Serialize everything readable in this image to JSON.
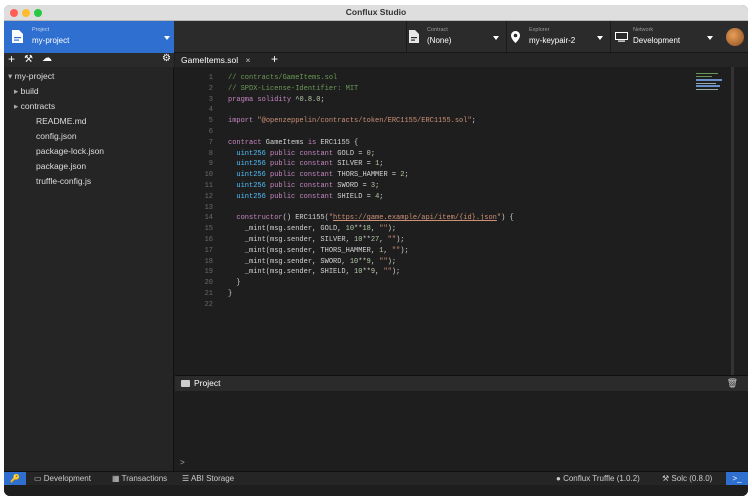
{
  "window": {
    "title": "Conflux Studio"
  },
  "topbar": {
    "project": {
      "label": "Project",
      "value": "my-project"
    },
    "contract": {
      "label": "Contract",
      "value": "(None)"
    },
    "explorer": {
      "label": "Explorer",
      "value": "my-keypair-2"
    },
    "network": {
      "label": "Network",
      "value": "Development"
    }
  },
  "sidebar": {
    "tree": [
      {
        "name": "my-project",
        "type": "folder-open"
      },
      {
        "name": "build",
        "type": "folder"
      },
      {
        "name": "contracts",
        "type": "folder"
      },
      {
        "name": "README.md",
        "type": "file"
      },
      {
        "name": "config.json",
        "type": "file"
      },
      {
        "name": "package-lock.json",
        "type": "file"
      },
      {
        "name": "package.json",
        "type": "file"
      },
      {
        "name": "truffle-config.js",
        "type": "file"
      }
    ]
  },
  "editor": {
    "tab": "GameItems.sol",
    "lines": [
      "// contracts/GameItems.sol",
      "// SPDX-License-Identifier: MIT",
      "pragma solidity ^0.8.0;",
      "",
      "import \"@openzeppelin/contracts/token/ERC1155/ERC1155.sol\";",
      "",
      "contract GameItems is ERC1155 {",
      "  uint256 public constant GOLD = 0;",
      "  uint256 public constant SILVER = 1;",
      "  uint256 public constant THORS_HAMMER = 2;",
      "  uint256 public constant SWORD = 3;",
      "  uint256 public constant SHIELD = 4;",
      "",
      "  constructor() ERC1155(\"https://game.example/api/item/{id}.json\") {",
      "    _mint(msg.sender, GOLD, 10**18, \"\");",
      "    _mint(msg.sender, SILVER, 10**27, \"\");",
      "    _mint(msg.sender, THORS_HAMMER, 1, \"\");",
      "    _mint(msg.sender, SWORD, 10**9, \"\");",
      "    _mint(msg.sender, SHIELD, 10**9, \"\");",
      "  }",
      "}",
      ""
    ]
  },
  "panel": {
    "title": "Project",
    "prompt": ">"
  },
  "statusbar": {
    "development": "Development",
    "transactions": "Transactions",
    "abi_storage": "ABI Storage",
    "truffle": "Conflux Truffle (1.0.2)",
    "solc": "Solc (0.8.0)"
  },
  "colors": {
    "accent": "#2f6fd0",
    "editor_bg": "#1e1e1e",
    "sidebar_bg": "#252526"
  }
}
